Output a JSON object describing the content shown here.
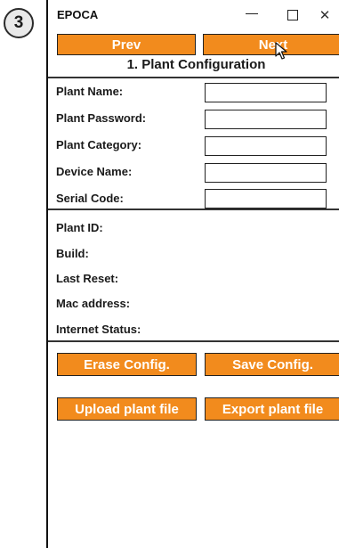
{
  "step_number": "3",
  "window": {
    "title": "EPOCA",
    "minimize_glyph": "—",
    "close_glyph": "✕"
  },
  "nav": {
    "prev_label": "Prev",
    "next_label": "Next"
  },
  "section_title": "1. Plant Configuration",
  "form": {
    "fields": [
      {
        "label": "Plant Name:",
        "value": ""
      },
      {
        "label": "Plant Password:",
        "value": ""
      },
      {
        "label": "Plant Category:",
        "value": ""
      },
      {
        "label": "Device Name:",
        "value": ""
      },
      {
        "label": "Serial Code:",
        "value": ""
      }
    ]
  },
  "info": {
    "items": [
      {
        "label": "Plant ID:"
      },
      {
        "label": "Build:"
      },
      {
        "label": "Last Reset:"
      },
      {
        "label": "Mac address:"
      },
      {
        "label": "Internet Status:"
      }
    ]
  },
  "actions": {
    "erase_label": "Erase Config.",
    "save_label": "Save Config.",
    "upload_label": "Upload plant file",
    "export_label": "Export plant file"
  },
  "colors": {
    "accent": "#f28b1d",
    "border": "#222222"
  }
}
